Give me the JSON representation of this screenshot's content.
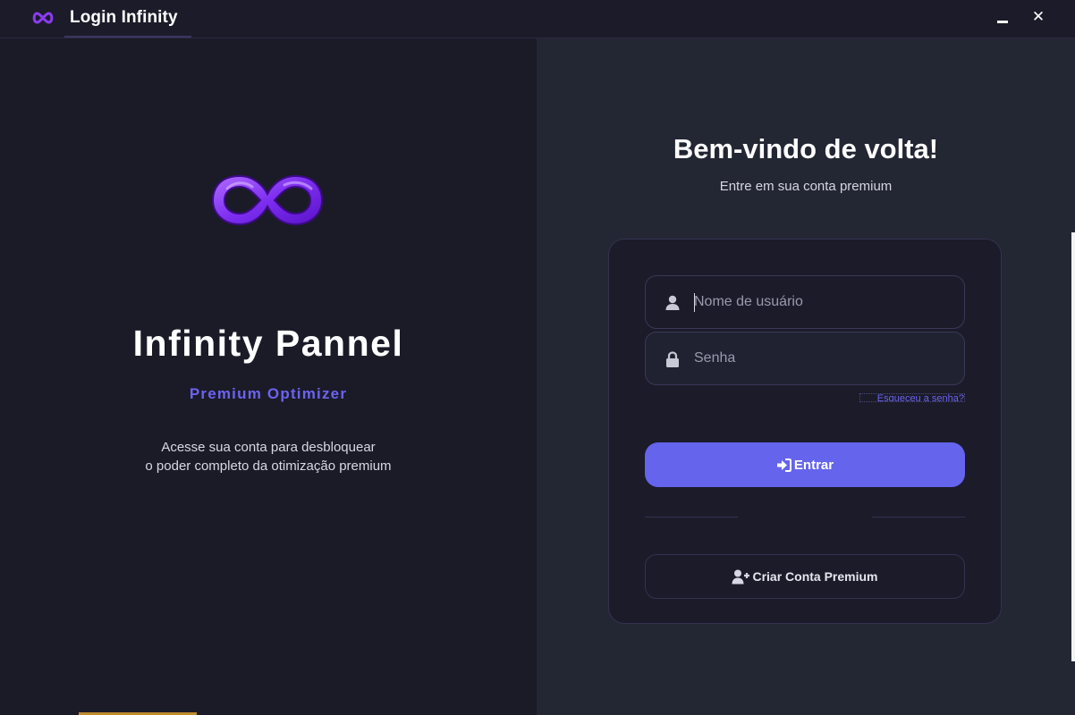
{
  "window": {
    "title": "Login Infinity",
    "minimize_icon": "minimize-icon",
    "close_label": "✕"
  },
  "left": {
    "logo_icon": "infinity-logo-icon",
    "brand_title": "Infinity Pannel",
    "brand_subtitle": "Premium Optimizer",
    "description_line1": "Acesse sua conta para desbloquear",
    "description_line2": "o poder completo da otimização premium"
  },
  "right": {
    "welcome_title": "Bem-vindo de volta!",
    "welcome_subtitle": "Entre em sua conta premium",
    "username": {
      "value": "",
      "placeholder": "Nome de usuário",
      "icon": "user-icon"
    },
    "password": {
      "value": "",
      "placeholder": "Senha",
      "icon": "lock-icon"
    },
    "forgot_password": "Esqueceu a senha?",
    "enter_button": {
      "label": "Entrar",
      "icon": "sign-in-icon"
    },
    "create_button": {
      "label": "Criar Conta Premium",
      "icon": "user-plus-icon"
    }
  },
  "colors": {
    "accent": "#6564ec",
    "accent_text": "#6c63f0",
    "left_bg": "#1b1b28",
    "right_bg": "#232633",
    "card_bg": "#1b1b2a"
  }
}
